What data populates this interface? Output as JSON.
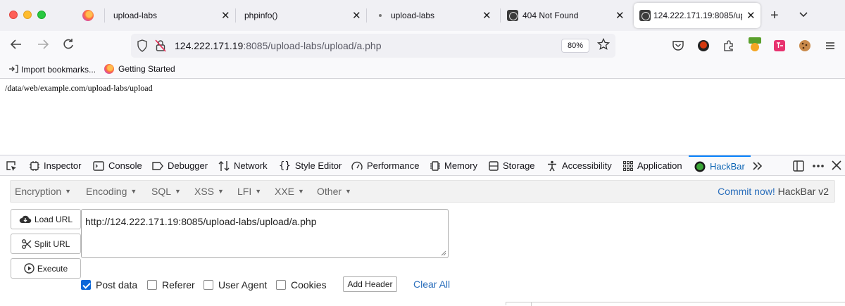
{
  "browser": {
    "tabs": [
      {
        "title": "upload-labs",
        "favicon": "firefox-icon"
      },
      {
        "title": "upload-labs",
        "favicon": "dot-icon"
      },
      {
        "title": "phpinfo()",
        "favicon": "none"
      },
      {
        "title": "upload-labs",
        "favicon": "dot-icon"
      },
      {
        "title": "404 Not Found",
        "favicon": "site-icon"
      },
      {
        "title": "124.222.171.19:8085/upl",
        "favicon": "site-icon",
        "active": true
      }
    ],
    "tab_close_glyph": "✕",
    "new_tab_glyph": "+",
    "list_tabs_glyph": "⌄",
    "url_host": "124.222.171.19",
    "url_rest": ":8085/upload-labs/upload/a.php",
    "zoom": "80%",
    "bookmarks": [
      {
        "label": "Import bookmarks...",
        "icon": "import-icon"
      },
      {
        "label": "Getting Started",
        "icon": "firefox-icon"
      }
    ]
  },
  "page": {
    "text": "/data/web/example.com/upload-labs/upload"
  },
  "devtools": {
    "tabs": [
      {
        "label": "Inspector",
        "icon": "inspector-icon"
      },
      {
        "label": "Console",
        "icon": "console-icon"
      },
      {
        "label": "Debugger",
        "icon": "debugger-icon"
      },
      {
        "label": "Network",
        "icon": "network-icon"
      },
      {
        "label": "Style Editor",
        "icon": "braces-icon"
      },
      {
        "label": "Performance",
        "icon": "gauge-icon"
      },
      {
        "label": "Memory",
        "icon": "memory-icon"
      },
      {
        "label": "Storage",
        "icon": "storage-icon"
      },
      {
        "label": "Accessibility",
        "icon": "accessibility-icon"
      },
      {
        "label": "Application",
        "icon": "grid-icon"
      },
      {
        "label": "HackBar",
        "icon": "hackbar-icon",
        "active": true
      }
    ],
    "accent_color": "#0a84ff"
  },
  "hackbar": {
    "menus": [
      "Encryption",
      "Encoding",
      "SQL",
      "XSS",
      "LFI",
      "XXE",
      "Other"
    ],
    "commit_link": "Commit now!",
    "version": "HackBar v2",
    "buttons": {
      "load": "Load URL",
      "split": "Split URL",
      "execute": "Execute"
    },
    "url_value": "http://124.222.171.19:8085/upload-labs/upload/a.php",
    "options": [
      {
        "label": "Post data",
        "checked": true
      },
      {
        "label": "Referer",
        "checked": false
      },
      {
        "label": "User Agent",
        "checked": false
      },
      {
        "label": "Cookies",
        "checked": false
      }
    ],
    "add_header": "Add Header",
    "clear_all": "Clear All",
    "link_color": "#2a6ebb"
  }
}
